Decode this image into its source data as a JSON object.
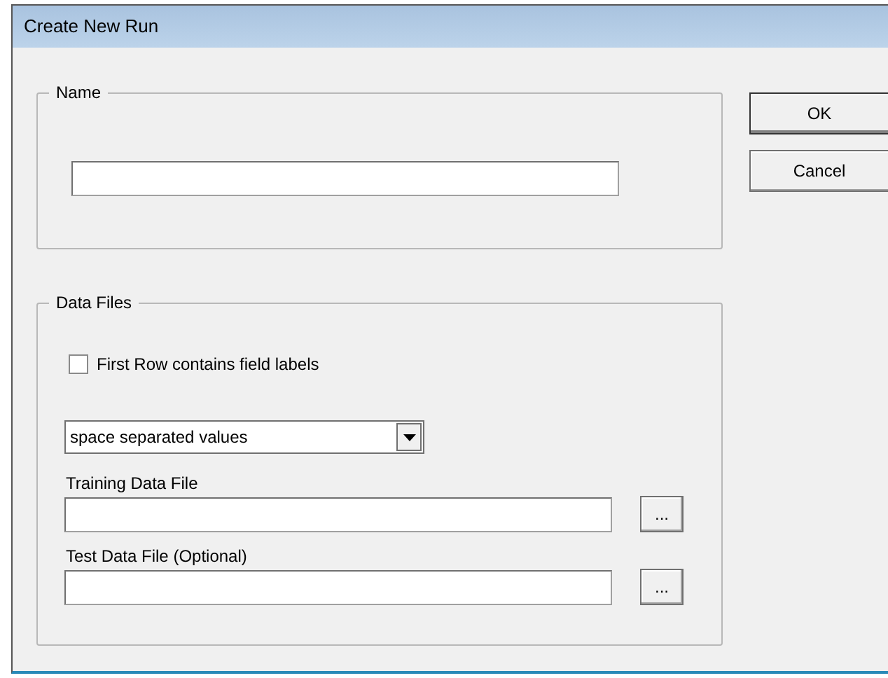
{
  "window": {
    "title": "Create New Run"
  },
  "name_group": {
    "legend": "Name"
  },
  "buttons": [
    {
      "label": "OK",
      "default": true
    },
    {
      "label": "Cancel",
      "default": false
    }
  ],
  "data_files_group": {
    "legend": "Data Files",
    "first_row_labels": {
      "label": "First Row contains field labels",
      "checked": false
    },
    "format_dropdown": {
      "value": "space separated values"
    },
    "files": [
      {
        "label": "Training Data File",
        "browse_label": "..."
      },
      {
        "label": "Test Data File (Optional)",
        "browse_label": "..."
      }
    ]
  }
}
